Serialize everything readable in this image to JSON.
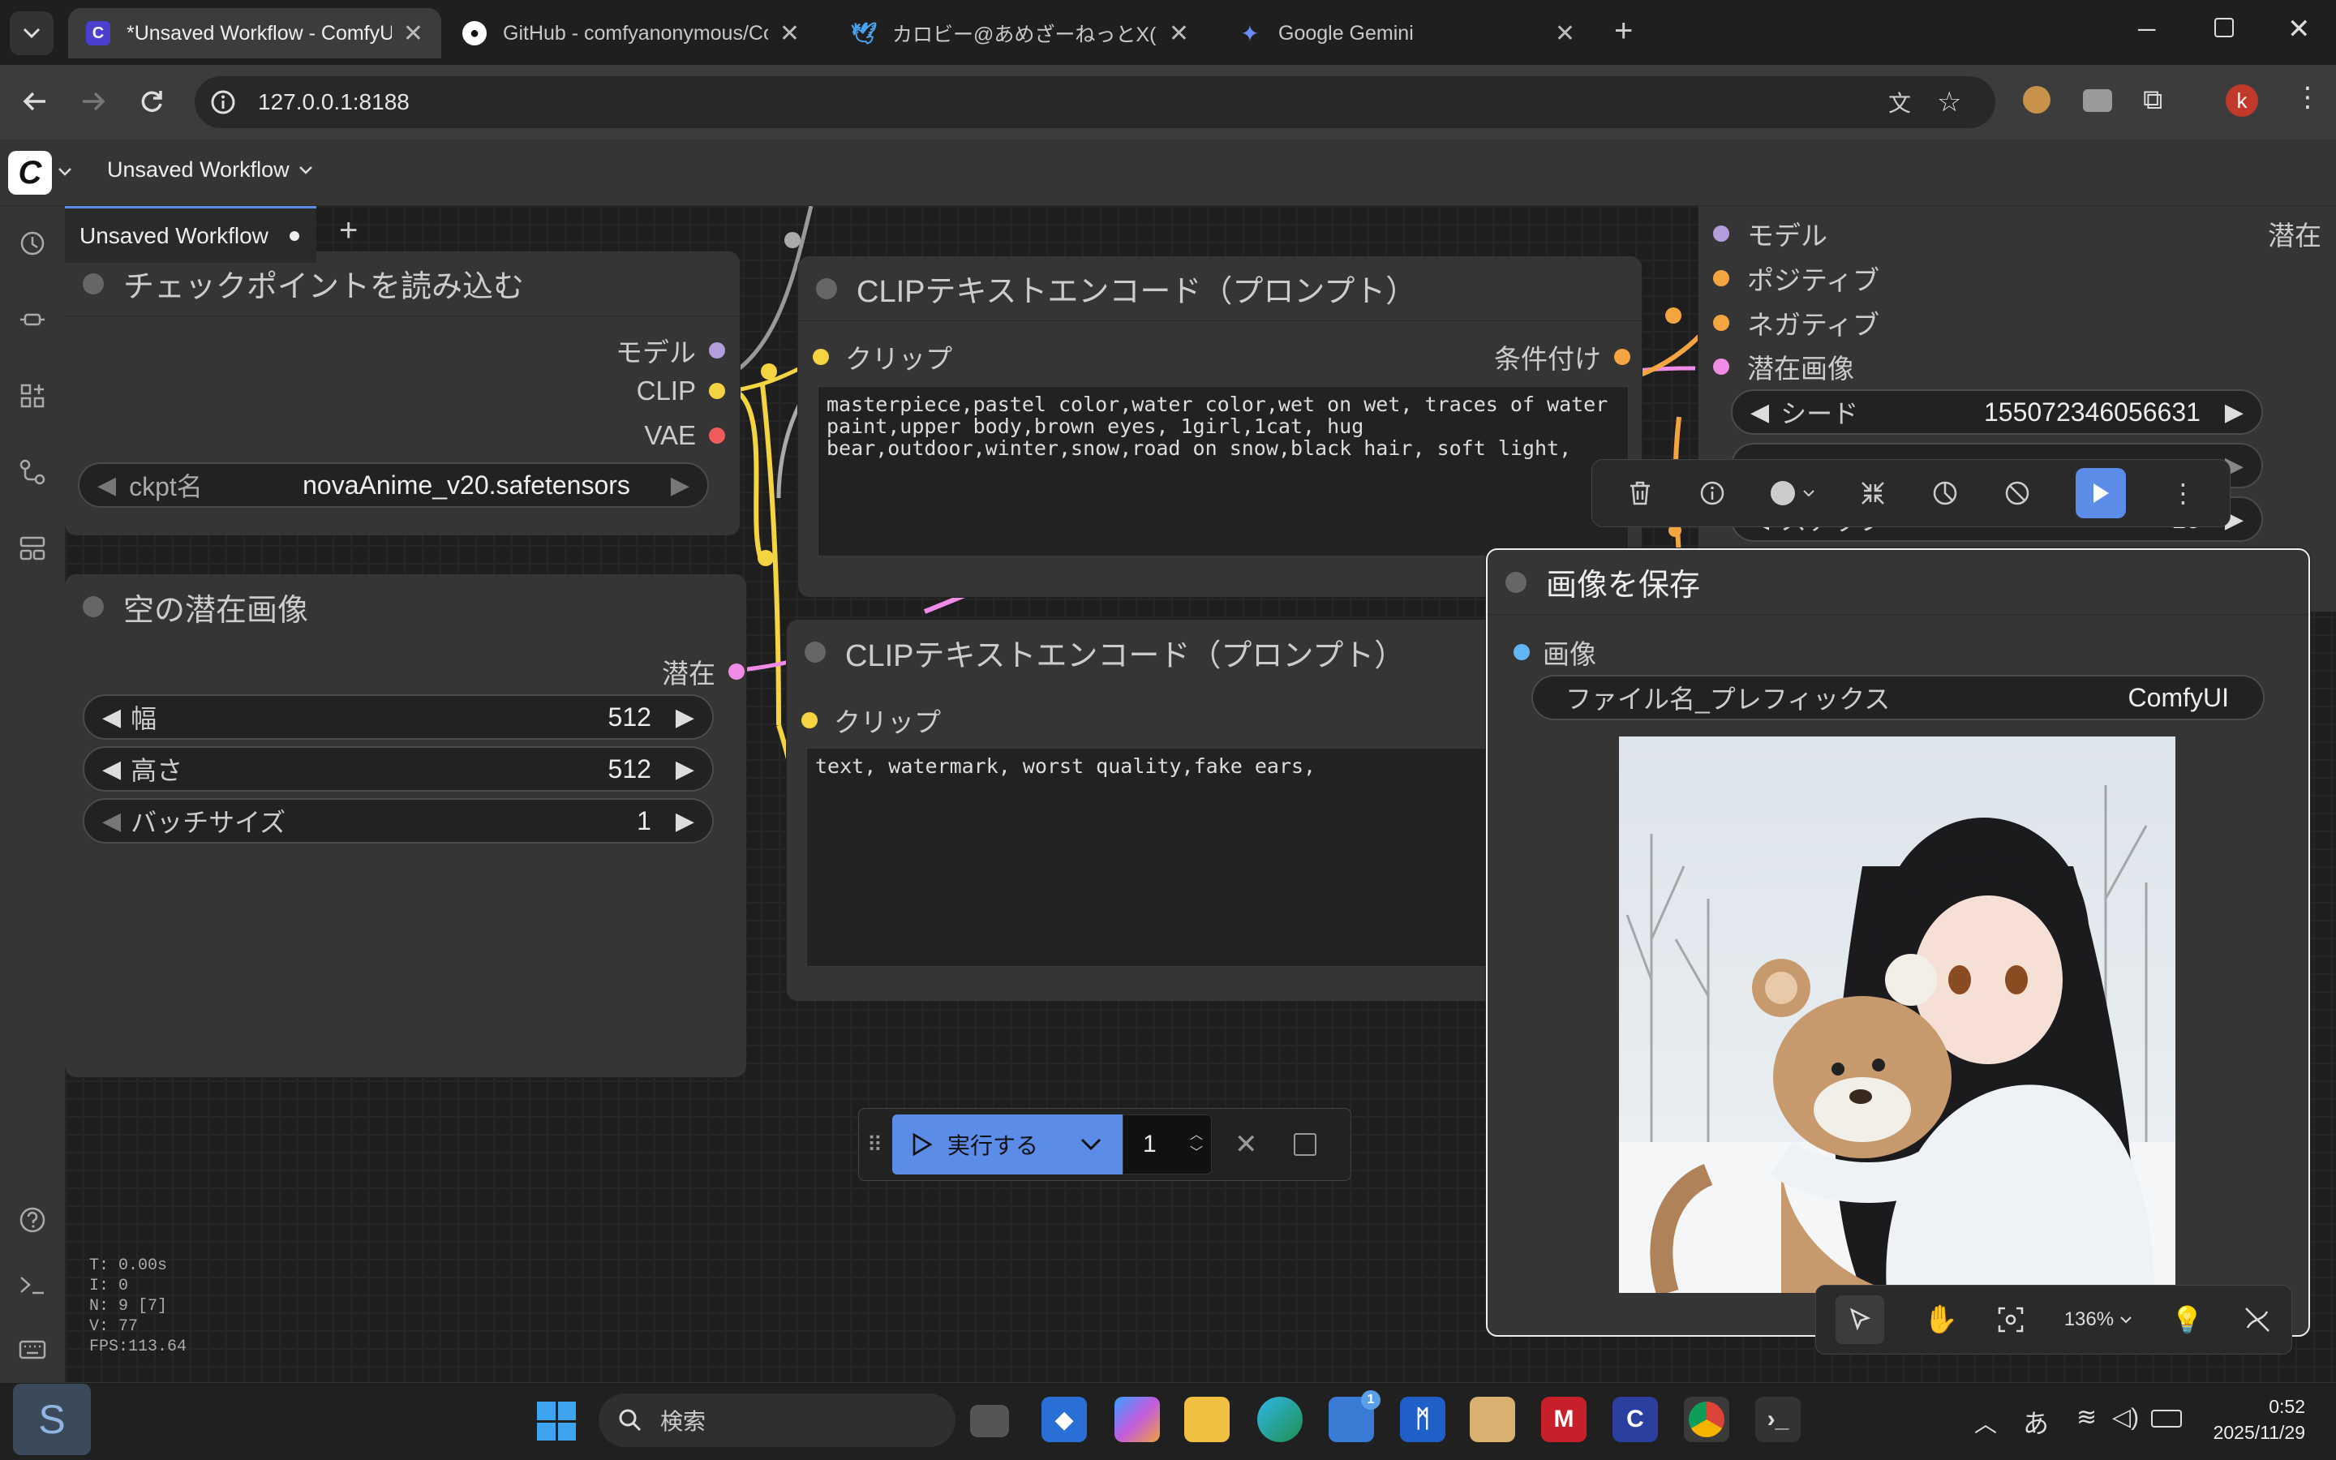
{
  "browser": {
    "tabs": [
      {
        "title": "*Unsaved Workflow - ComfyUI",
        "active": true
      },
      {
        "title": "GitHub - comfyanonymous/Co"
      },
      {
        "title": "カロビー@あめざーねっとX(旧Twitter"
      },
      {
        "title": "Google Gemini"
      }
    ],
    "url": "127.0.0.1:8188",
    "profile_initial": "k"
  },
  "topbar": {
    "workflow_menu": "Unsaved Workflow"
  },
  "workflow_tab": {
    "label": "Unsaved Workflow"
  },
  "nodes": {
    "checkpoint": {
      "title": "チェックポイントを読み込む",
      "out_model": "モデル",
      "out_clip": "CLIP",
      "out_vae": "VAE",
      "w_label": "ckpt名",
      "w_value": "novaAnime_v20.safetensors"
    },
    "latent": {
      "title": "空の潜在画像",
      "out_latent": "潜在",
      "width_label": "幅",
      "width_value": "512",
      "height_label": "高さ",
      "height_value": "512",
      "batch_label": "バッチサイズ",
      "batch_value": "1"
    },
    "clip_pos": {
      "title": "CLIPテキストエンコード（プロンプト）",
      "in_clip": "クリップ",
      "out_cond": "条件付け",
      "text": "masterpiece,pastel color,water color,wet on wet, traces of water\npaint,upper body,brown eyes, 1girl,1cat, hug\nbear,outdoor,winter,snow,road on snow,black hair, soft light,"
    },
    "clip_neg": {
      "title": "CLIPテキストエンコード（プロンプト）",
      "in_clip": "クリップ",
      "text": "text, watermark, worst quality,fake ears,"
    },
    "ksampler": {
      "in_model": "モデル",
      "in_pos": "ポジティブ",
      "in_neg": "ネガティブ",
      "in_latent": "潜在画像",
      "out_latent": "潜在",
      "seed_label": "シード",
      "seed_value": "155072346056631",
      "steps_label": "ステップ",
      "steps_value": "10"
    },
    "save": {
      "title": "画像を保存",
      "in_image": "画像",
      "prefix_label": "ファイル名_プレフィックス",
      "prefix_value": "ComfyUI"
    }
  },
  "run_bar": {
    "run_label": "実行する",
    "count": "1"
  },
  "canvas_controls": {
    "zoom": "136%"
  },
  "stats": {
    "t": "T: 0.00s",
    "i": "I: 0",
    "n": "N: 9 [7]",
    "v": "V: 77",
    "fps": "FPS:113.64"
  },
  "taskbar": {
    "search_placeholder": "検索",
    "ime": "あ",
    "time": "0:52",
    "date": "2025/11/29",
    "store_badge": "1"
  },
  "colors": {
    "accent": "#5a8ce8",
    "model": "#b39ddb",
    "clip": "#f5d442",
    "vae": "#f05b5b",
    "latent": "#f08ce8",
    "cond": "#f5a540",
    "image": "#64b5f6"
  }
}
